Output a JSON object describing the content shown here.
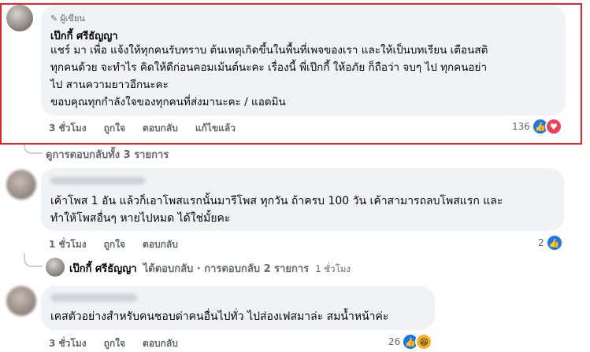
{
  "comment1": {
    "author_badge": "ผู้เขียน",
    "author": "เป๊กกี้ ศรีธัญญา",
    "lines": [
      "แชร์ มา เพื่อ แจ้งให้ทุกคนรับทราบ ต้นเหตุเกิดขึ้นในพื้นที่เพจของเรา และให้เป็นบทเรียน เตือนสติ",
      "ทุกคนด้วย จะทำไร คิดให้ดีก่อนคอมเม้นต์นะคะ เรื่องนี้ พี่เป๊กกี้ ให้อภัย ก็ถือว่า จบๆ ไป ทุกคนอย่า",
      "ไป สานความยาวอีกนะคะ",
      "ขอบคุณทุกกำลังใจของทุกคนที่ส่งมานะคะ / แอดมิน"
    ],
    "time": "3 ชั่วโมง",
    "like": "ถูกใจ",
    "reply": "ตอบกลับ",
    "edited": "แก้ไขแล้ว",
    "reaction_count": "136",
    "reaction_icons": [
      "like-icon",
      "love-icon"
    ]
  },
  "view_replies": "ดูการตอบกลับทั้ง 3 รายการ",
  "comment2": {
    "lines": [
      "เค้าโพส 1 อัน แล้วก็เอาโพสแรกนั้นมารีโพส ทุกวัน ถ้าครบ 100 วัน เค้าสามารถลบโพสแรก และ",
      "ทำให้โพสอื่นๆ หายไปหมด ได้ใช่มั้ยคะ"
    ],
    "time": "1 ชั่วโมง",
    "like": "ถูกใจ",
    "reply": "ตอบกลับ",
    "reaction_count": "2",
    "reaction_icons": [
      "like-icon"
    ]
  },
  "reply_summary": {
    "author": "เป๊กกี้ ศรีธัญญา",
    "text": "ได้ตอบกลับ · การตอบกลับ 2 รายการ",
    "time": "1 ชั่วโมง"
  },
  "comment3": {
    "text": "เคสตัวอย่างสำหรับคนชอบด่าคนอื่นไปทั่ว ไปส่องเฟสมาล่ะ สมน้ำหน้าค่ะ",
    "time": "3 ชั่วโมง",
    "like": "ถูกใจ",
    "reply": "ตอบกลับ",
    "reaction_count": "26",
    "reaction_icons": [
      "like-icon",
      "haha-icon"
    ]
  },
  "colors": {
    "highlight_border": "#e0242a",
    "bubble_bg": "#f0f2f5",
    "like_blue": "#1877f2",
    "love_red": "#f33e58",
    "haha_yellow": "#f7b125",
    "meta_gray": "#65676b"
  }
}
